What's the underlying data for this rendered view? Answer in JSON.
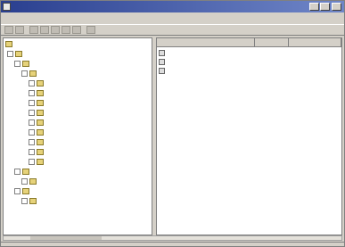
{
  "window": {
    "title": "",
    "accent": "#2a3f8f"
  },
  "menu": {
    "items": [
      "",
      "",
      "",
      "",
      "",
      ""
    ]
  },
  "toolbar": {
    "icons": [
      "back-icon",
      "forward-icon",
      "up-icon",
      "delete-icon",
      "properties-icon",
      "refresh-icon",
      "export-icon",
      "help-icon"
    ]
  },
  "tree": {
    "root": "",
    "nodes": [
      {
        "depth": 0,
        "label": ""
      },
      {
        "depth": 1,
        "label": ""
      },
      {
        "depth": 2,
        "label": ""
      },
      {
        "depth": 3,
        "label": ""
      },
      {
        "depth": 3,
        "label": ""
      },
      {
        "depth": 3,
        "label": ""
      },
      {
        "depth": 3,
        "label": ""
      },
      {
        "depth": 3,
        "label": ""
      },
      {
        "depth": 3,
        "label": ""
      },
      {
        "depth": 3,
        "label": ""
      },
      {
        "depth": 3,
        "label": ""
      },
      {
        "depth": 3,
        "label": ""
      },
      {
        "depth": 1,
        "label": ""
      },
      {
        "depth": 2,
        "label": ""
      },
      {
        "depth": 1,
        "label": ""
      },
      {
        "depth": 2,
        "label": ""
      }
    ]
  },
  "list": {
    "columns": [
      "",
      "",
      ""
    ],
    "rows": [
      {
        "name": "",
        "class": "",
        "dn": ""
      },
      {
        "name": "",
        "class": "",
        "dn": ""
      },
      {
        "name": "",
        "class": "",
        "dn": ""
      }
    ]
  }
}
